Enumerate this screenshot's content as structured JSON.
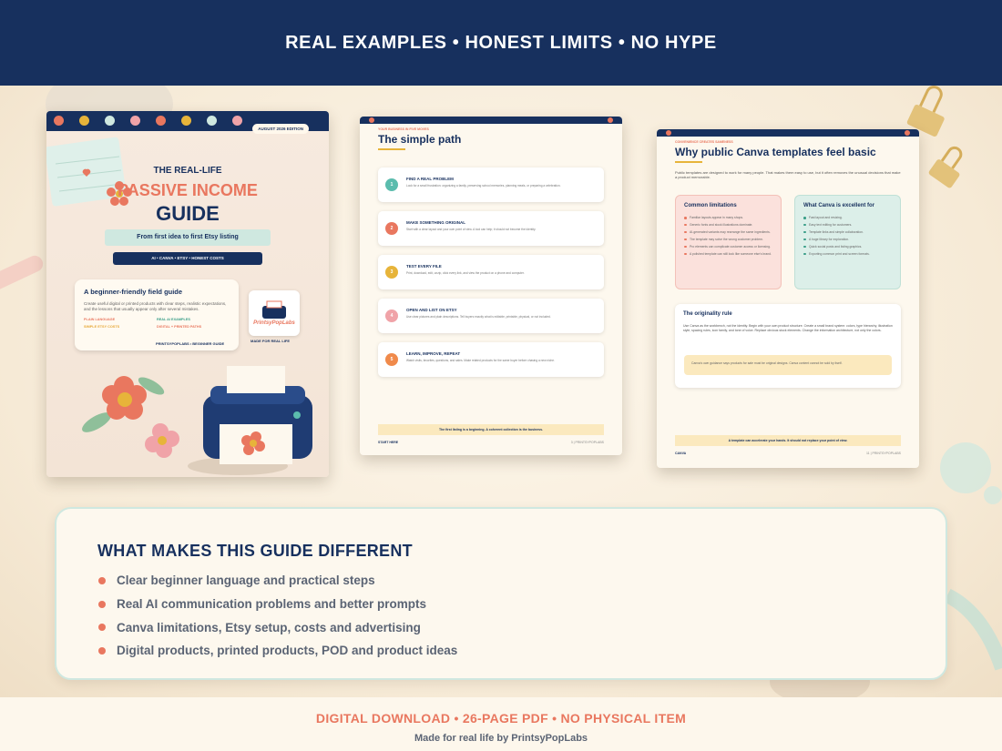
{
  "banner": {
    "title": "REAL EXAMPLES • HONEST LIMITS • NO HYPE"
  },
  "cover": {
    "edition": "AUGUST 2026 EDITION",
    "title_small": "THE REAL-LIFE",
    "title_main": "PASSIVE INCOME",
    "title_guide": "GUIDE",
    "subtitle": "From first idea to first Etsy listing",
    "tags": "AI • CANVA • ETSY • HONEST COSTS",
    "card_title": "A beginner-friendly field guide",
    "card_text": "Create useful digital or printed products with clear steps, realistic expectations, and the lessons that usually appear only after several mistakes.",
    "card_tags": [
      "PLAIN LANGUAGE",
      "REAL AI EXAMPLES",
      "SIMPLE ETSY COSTS",
      "DIGITAL + PRINTED PATHS"
    ],
    "brand_line": "PRINTSYPOPLABS • BEGINNER GUIDE",
    "logo_text": "PrintsyPopLabs",
    "made_for": "MADE FOR REAL LIFE"
  },
  "page2": {
    "eyebrow": "YOUR BUSINESS IN FIVE MOVES",
    "title": "The simple path",
    "steps": [
      {
        "num": "1",
        "title": "FIND A REAL PROBLEM",
        "desc": "Look for a small frustration: organizing a family, preserving school memories, planning meals, or preparing a celebration.",
        "color": "#5bbcad"
      },
      {
        "num": "2",
        "title": "MAKE SOMETHING ORIGINAL",
        "desc": "Start with a clear layout and your own point of view. A tool can help; it should not become the identity.",
        "color": "#e9775f"
      },
      {
        "num": "3",
        "title": "TEST EVERY FILE",
        "desc": "Print, download, edit, unzip, click every link, and view the product on a phone and computer.",
        "color": "#e7b43a"
      },
      {
        "num": "4",
        "title": "OPEN AND LIST ON ETSY",
        "desc": "Use clear pictures and plain descriptions. Tell buyers exactly what is editable, printable, physical, or not included.",
        "color": "#f0a3a8"
      },
      {
        "num": "5",
        "title": "LEARN, IMPROVE, REPEAT",
        "desc": "Watch visits, favorites, questions, and sales. Make related products for the same buyer before chasing a new niche.",
        "color": "#f08a4b"
      }
    ],
    "footer_note": "The first listing is a beginning. A coherent collection is the business.",
    "footer_left": "START HERE",
    "footer_right": "3 | PRINTSYPOPLABS"
  },
  "page3": {
    "eyebrow": "CONVENIENCE CREATES SAMENESS",
    "title": "Why public Canva templates feel basic",
    "intro": "Public templates are designed to work for many people. That makes them easy to use, but it often removes the unusual decisions that make a product memorable.",
    "limits_title": "Common limitations",
    "limits": [
      "Familiar layouts appear in many shops.",
      "Generic fonts and stock illustrations dominate.",
      "AI-generated variants may rearrange the same ingredients.",
      "The template may solve the wrong customer problem.",
      "Pro elements can complicate customer access or licensing.",
      "A polished template can still look like someone else's brand."
    ],
    "good_title": "What Canva is excellent for",
    "good": [
      "Fast layout and resizing.",
      "Easy text editing for customers.",
      "Template links and simple collaboration.",
      "A huge library for exploration.",
      "Quick social posts and listing graphics.",
      "Exporting common print and screen formats."
    ],
    "orig_title": "The originality rule",
    "orig_text": "Use Canva as the workbench, not the identity. Begin with your own product structure. Create a small brand system: colors, type hierarchy, illustration style, spacing rules, icon family, and tone of voice. Replace obvious stock elements. Change the information architecture, not only the colors.",
    "orig_note": "Canva's own guidance says products for sale must be original designs. Canva content cannot be sold by itself.",
    "footer_note": "A template can accelerate your hands. It should not replace your point of view.",
    "footer_left": "CANVA",
    "footer_right": "11 | PRINTSYPOPLABS"
  },
  "panel": {
    "title": "WHAT MAKES THIS GUIDE DIFFERENT",
    "items": [
      "Clear beginner language and practical steps",
      "Real AI communication problems and better prompts",
      "Canva limitations, Etsy setup, costs and advertising",
      "Digital products, printed products, POD and product ideas"
    ]
  },
  "footer": {
    "line1": "DIGITAL DOWNLOAD  •  26-PAGE PDF  •  NO PHYSICAL ITEM",
    "line2": "Made for real life by PrintsyPopLabs"
  },
  "colors": {
    "navy": "#17305e",
    "coral": "#e9775f",
    "mint": "#cfe8e0",
    "cream": "#fdf8ee",
    "gold": "#e7b43a"
  }
}
